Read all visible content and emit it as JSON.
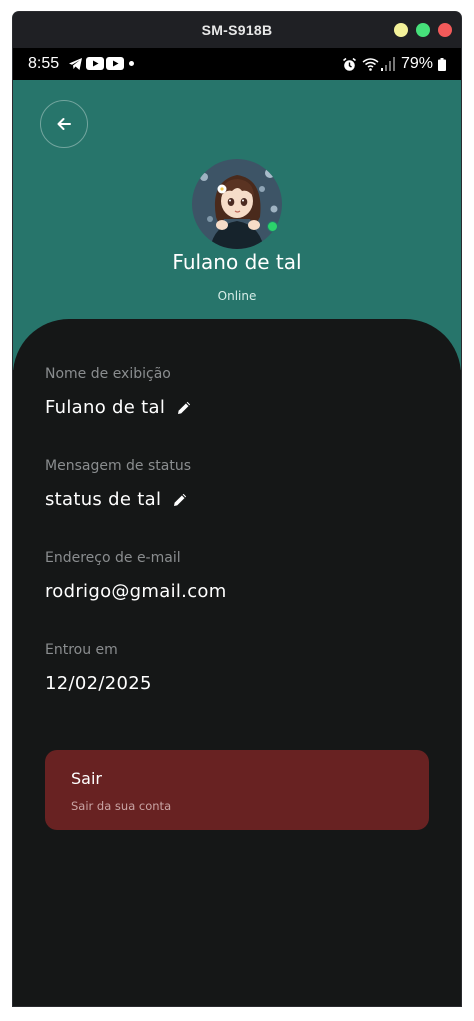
{
  "window": {
    "title": "SM-S918B",
    "controls": [
      "minimize",
      "maximize",
      "close"
    ]
  },
  "statusbar": {
    "time": "8:55",
    "left_icons": [
      "telegram-icon",
      "youtube-icon",
      "youtube-icon",
      "notification-dot"
    ],
    "right_icons": [
      "alarm-icon",
      "wifi-icon",
      "signal-icon"
    ],
    "battery": "79%"
  },
  "profile": {
    "name": "Fulano de tal",
    "presence": "Online",
    "accent_color": "#27756b",
    "presence_color": "#2bd36b"
  },
  "fields": [
    {
      "label": "Nome de exibição",
      "value": "Fulano de tal",
      "editable": true
    },
    {
      "label": "Mensagem de status",
      "value": "status de tal",
      "editable": true
    },
    {
      "label": "Endereço de e-mail",
      "value": "rodrigo@gmail.com",
      "editable": false
    },
    {
      "label": "Entrou em",
      "value": "12/02/2025",
      "editable": false
    }
  ],
  "logout": {
    "title": "Sair",
    "subtitle": "Sair da sua conta",
    "color": "#682222"
  }
}
